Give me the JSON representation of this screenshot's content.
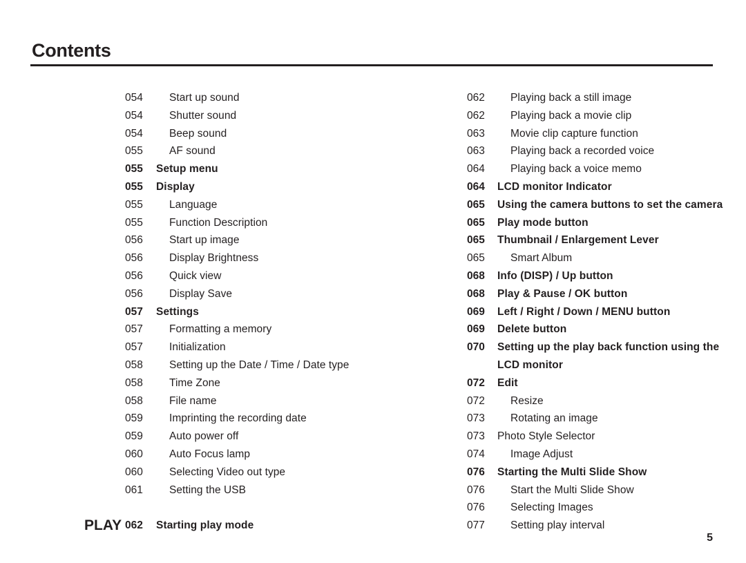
{
  "header": {
    "title": "Contents"
  },
  "page_number": "5",
  "columns": {
    "left": [
      {
        "marker": "",
        "number": "054",
        "label": "Start up sound",
        "bold": false,
        "sub": true
      },
      {
        "marker": "",
        "number": "054",
        "label": "Shutter sound",
        "bold": false,
        "sub": true
      },
      {
        "marker": "",
        "number": "054",
        "label": "Beep sound",
        "bold": false,
        "sub": true
      },
      {
        "marker": "",
        "number": "055",
        "label": "AF sound",
        "bold": false,
        "sub": true
      },
      {
        "marker": "",
        "number": "055",
        "label": "Setup menu",
        "bold": true,
        "sub": false
      },
      {
        "marker": "",
        "number": "055",
        "label": "Display",
        "bold": true,
        "sub": false
      },
      {
        "marker": "",
        "number": "055",
        "label": "Language",
        "bold": false,
        "sub": true
      },
      {
        "marker": "",
        "number": "055",
        "label": "Function Description",
        "bold": false,
        "sub": true
      },
      {
        "marker": "",
        "number": "056",
        "label": "Start up image",
        "bold": false,
        "sub": true
      },
      {
        "marker": "",
        "number": "056",
        "label": "Display Brightness",
        "bold": false,
        "sub": true
      },
      {
        "marker": "",
        "number": "056",
        "label": "Quick view",
        "bold": false,
        "sub": true
      },
      {
        "marker": "",
        "number": "056",
        "label": "Display Save",
        "bold": false,
        "sub": true
      },
      {
        "marker": "",
        "number": "057",
        "label": "Settings",
        "bold": true,
        "sub": false
      },
      {
        "marker": "",
        "number": "057",
        "label": "Formatting a memory",
        "bold": false,
        "sub": true
      },
      {
        "marker": "",
        "number": "057",
        "label": "Initialization",
        "bold": false,
        "sub": true
      },
      {
        "marker": "",
        "number": "058",
        "label": "Setting up the Date / Time / Date type",
        "bold": false,
        "sub": true
      },
      {
        "marker": "",
        "number": "058",
        "label": "Time Zone",
        "bold": false,
        "sub": true
      },
      {
        "marker": "",
        "number": "058",
        "label": "File name",
        "bold": false,
        "sub": true
      },
      {
        "marker": "",
        "number": "059",
        "label": "Imprinting the recording date",
        "bold": false,
        "sub": true
      },
      {
        "marker": "",
        "number": "059",
        "label": "Auto power off",
        "bold": false,
        "sub": true
      },
      {
        "marker": "",
        "number": "060",
        "label": "Auto Focus lamp",
        "bold": false,
        "sub": true
      },
      {
        "marker": "",
        "number": "060",
        "label": "Selecting Video out type",
        "bold": false,
        "sub": true
      },
      {
        "marker": "",
        "number": "061",
        "label": "Setting the USB",
        "bold": false,
        "sub": true
      },
      {
        "spacer": true
      },
      {
        "marker": "PLAY",
        "number": "062",
        "label": "Starting play mode",
        "bold": true,
        "sub": false
      }
    ],
    "right": [
      {
        "marker": "",
        "number": "062",
        "label": "Playing back a still image",
        "bold": false,
        "sub": true
      },
      {
        "marker": "",
        "number": "062",
        "label": "Playing back a movie clip",
        "bold": false,
        "sub": true
      },
      {
        "marker": "",
        "number": "063",
        "label": "Movie clip capture function",
        "bold": false,
        "sub": true
      },
      {
        "marker": "",
        "number": "063",
        "label": "Playing back a recorded voice",
        "bold": false,
        "sub": true
      },
      {
        "marker": "",
        "number": "064",
        "label": "Playing back a voice memo",
        "bold": false,
        "sub": true
      },
      {
        "marker": "",
        "number": "064",
        "label": "LCD monitor Indicator",
        "bold": true,
        "sub": false
      },
      {
        "marker": "",
        "number": "065",
        "label": "Using the camera buttons to set the camera",
        "bold": true,
        "sub": false
      },
      {
        "marker": "",
        "number": "065",
        "label": "Play mode button",
        "bold": true,
        "sub": false
      },
      {
        "marker": "",
        "number": "065",
        "label": "Thumbnail / Enlargement Lever",
        "bold": true,
        "sub": false
      },
      {
        "marker": "",
        "number": "065",
        "label": "Smart Album",
        "bold": false,
        "sub": true
      },
      {
        "marker": "",
        "number": "068",
        "label": "Info (DISP) / Up button",
        "bold": true,
        "sub": false
      },
      {
        "marker": "",
        "number": "068",
        "label": "Play & Pause / OK button",
        "bold": true,
        "sub": false
      },
      {
        "marker": "",
        "number": "069",
        "label": "Left / Right / Down / MENU button",
        "bold": true,
        "sub": false
      },
      {
        "marker": "",
        "number": "069",
        "label": "Delete button",
        "bold": true,
        "sub": false
      },
      {
        "marker": "",
        "number": "070",
        "label": "Setting up the play back function using the LCD monitor",
        "bold": true,
        "sub": false,
        "wrap": true
      },
      {
        "marker": "",
        "number": "072",
        "label": "Edit",
        "bold": true,
        "sub": false
      },
      {
        "marker": "",
        "number": "072",
        "label": "Resize",
        "bold": false,
        "sub": true
      },
      {
        "marker": "",
        "number": "073",
        "label": "Rotating an image",
        "bold": false,
        "sub": true
      },
      {
        "marker": "",
        "number": "073",
        "label": "Photo Style Selector",
        "bold": false,
        "sub": false
      },
      {
        "marker": "",
        "number": "074",
        "label": "Image Adjust",
        "bold": false,
        "sub": true
      },
      {
        "marker": "",
        "number": "076",
        "label": "Starting the Multi Slide Show",
        "bold": true,
        "sub": false
      },
      {
        "marker": "",
        "number": "076",
        "label": "Start the Multi Slide Show",
        "bold": false,
        "sub": true
      },
      {
        "marker": "",
        "number": "076",
        "label": "Selecting Images",
        "bold": false,
        "sub": true
      },
      {
        "marker": "",
        "number": "077",
        "label": "Setting play interval",
        "bold": false,
        "sub": true
      }
    ]
  }
}
